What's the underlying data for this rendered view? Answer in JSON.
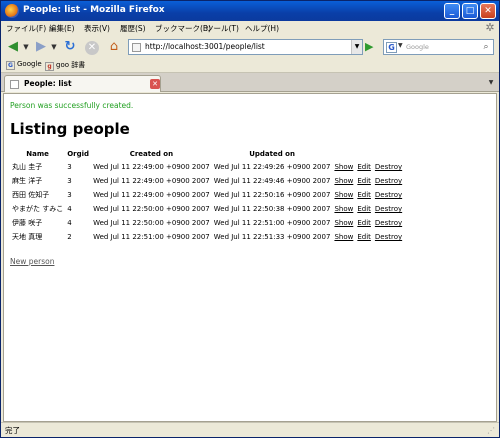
{
  "window": {
    "title": "People: list - Mozilla Firefox"
  },
  "menu": [
    "ファイル(F)",
    "編集(E)",
    "表示(V)",
    "履歴(S)",
    "ブックマーク(B)",
    "ツール(T)",
    "ヘルプ(H)"
  ],
  "nav": {
    "url": "http://localhost:3001/people/list",
    "search_placeholder": "Google",
    "search_engine_letter": "G"
  },
  "bookmarks": [
    {
      "label": "Google",
      "icon": "G"
    },
    {
      "label": "goo 辞書",
      "icon": "g"
    }
  ],
  "tab": {
    "label": "People: list"
  },
  "page": {
    "notice": "Person was successfully created.",
    "heading": "Listing people",
    "columns": [
      "Name",
      "Orgid",
      "Created on",
      "Updated on"
    ],
    "rows": [
      {
        "name": "丸山 圭子",
        "orgid": "3",
        "created": "Wed Jul 11 22:49:00 +0900 2007",
        "updated": "Wed Jul 11 22:49:26 +0900 2007"
      },
      {
        "name": "麻生 洋子",
        "orgid": "3",
        "created": "Wed Jul 11 22:49:00 +0900 2007",
        "updated": "Wed Jul 11 22:49:46 +0900 2007"
      },
      {
        "name": "西田 佐知子",
        "orgid": "3",
        "created": "Wed Jul 11 22:49:00 +0900 2007",
        "updated": "Wed Jul 11 22:50:16 +0900 2007"
      },
      {
        "name": "やまがた すみこ",
        "orgid": "4",
        "created": "Wed Jul 11 22:50:00 +0900 2007",
        "updated": "Wed Jul 11 22:50:38 +0900 2007"
      },
      {
        "name": "伊藤 咲子",
        "orgid": "4",
        "created": "Wed Jul 11 22:50:00 +0900 2007",
        "updated": "Wed Jul 11 22:51:00 +0900 2007"
      },
      {
        "name": "天地 真理",
        "orgid": "2",
        "created": "Wed Jul 11 22:51:00 +0900 2007",
        "updated": "Wed Jul 11 22:51:33 +0900 2007"
      }
    ],
    "actions": {
      "show": "Show",
      "edit": "Edit",
      "destroy": "Destroy"
    },
    "new_link": "New person"
  },
  "status": {
    "text": "完了"
  }
}
